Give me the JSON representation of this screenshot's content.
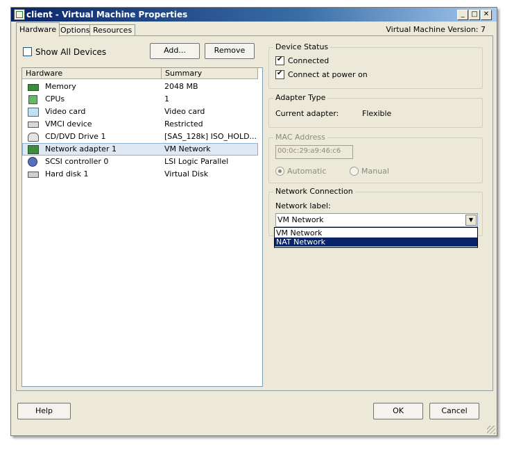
{
  "window": {
    "title": "client - Virtual Machine Properties",
    "version_label": "Virtual Machine Version: 7"
  },
  "title_buttons": {
    "minimize": "_",
    "maximize": "□",
    "close": "✕"
  },
  "tabs": [
    {
      "label": "Hardware",
      "active": true
    },
    {
      "label": "Options",
      "active": false
    },
    {
      "label": "Resources",
      "active": false
    }
  ],
  "left": {
    "show_all_devices": {
      "label": "Show All Devices",
      "checked": false
    },
    "add_label": "Add...",
    "remove_label": "Remove",
    "columns": {
      "hardware": "Hardware",
      "summary": "Summary"
    },
    "rows": [
      {
        "name": "Memory",
        "summary": "2048 MB",
        "icon": "memory-icon"
      },
      {
        "name": "CPUs",
        "summary": "1",
        "icon": "cpu-icon"
      },
      {
        "name": "Video card",
        "summary": "Video card",
        "icon": "monitor-icon"
      },
      {
        "name": "VMCI device",
        "summary": "Restricted",
        "icon": "device-icon"
      },
      {
        "name": "CD/DVD Drive 1",
        "summary": "[SAS_128k] ISO_HOLD...",
        "icon": "cd-drive-icon"
      },
      {
        "name": "Network adapter 1",
        "summary": "VM Network",
        "icon": "network-adapter-icon",
        "selected": true
      },
      {
        "name": "SCSI controller 0",
        "summary": "LSI Logic Parallel",
        "icon": "scsi-icon"
      },
      {
        "name": "Hard disk 1",
        "summary": "Virtual Disk",
        "icon": "hard-disk-icon"
      }
    ]
  },
  "device_status": {
    "title": "Device Status",
    "connected": {
      "label": "Connected",
      "checked": true
    },
    "connect_power_on": {
      "label": "Connect at power on",
      "checked": true
    }
  },
  "adapter_type": {
    "title": "Adapter Type",
    "current_label": "Current adapter:",
    "current_value": "Flexible"
  },
  "mac_address": {
    "title": "MAC Address",
    "value": "00:0c:29:a9:46:c6",
    "automatic_label": "Automatic",
    "manual_label": "Manual"
  },
  "network_connection": {
    "title": "Network Connection",
    "label": "Network label:",
    "selected": "VM Network",
    "options": [
      "VM Network",
      "NAT Network"
    ],
    "highlighted_option": "NAT Network"
  },
  "footer": {
    "help_label": "Help",
    "ok_label": "OK",
    "cancel_label": "Cancel"
  }
}
